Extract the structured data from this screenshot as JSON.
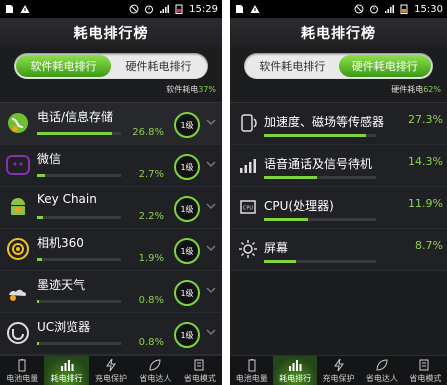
{
  "status": {
    "time": "15:29",
    "time_right": "15:30"
  },
  "left": {
    "title": "耗电排行榜",
    "tabs": [
      "软件耗电排行",
      "硬件耗电排行"
    ],
    "summary_label": "软件耗电",
    "summary_pct": "37%",
    "apps": [
      {
        "name": "电话/信息存储",
        "pct": "26.8%",
        "fill": 0.268,
        "level": "1级"
      },
      {
        "name": "微信",
        "pct": "2.7%",
        "fill": 0.027,
        "level": "1级"
      },
      {
        "name": "Key Chain",
        "pct": "2.2%",
        "fill": 0.022,
        "level": "1级"
      },
      {
        "name": "相机360",
        "pct": "1.9%",
        "fill": 0.019,
        "level": "1级"
      },
      {
        "name": "墨迹天气",
        "pct": "0.8%",
        "fill": 0.008,
        "level": "1级"
      },
      {
        "name": "UC浏览器",
        "pct": "0.8%",
        "fill": 0.008,
        "level": "1级"
      }
    ]
  },
  "right": {
    "title": "耗电排行榜",
    "tabs": [
      "软件耗电排行",
      "硬件耗电排行"
    ],
    "summary_label": "硬件耗电",
    "summary_pct": "62%",
    "hardware": [
      {
        "name": "加速度、磁场等传感器",
        "pct": "27.3%",
        "fill": 0.273,
        "icon": "sensor-icon"
      },
      {
        "name": "语音通话及信号待机",
        "pct": "14.3%",
        "fill": 0.143,
        "icon": "signal-icon"
      },
      {
        "name": "CPU(处理器)",
        "pct": "11.9%",
        "fill": 0.119,
        "icon": "cpu-icon"
      },
      {
        "name": "屏幕",
        "pct": "8.7%",
        "fill": 0.087,
        "icon": "brightness-icon"
      }
    ]
  },
  "nav": [
    "电池电量",
    "耗电排行",
    "充电保护",
    "省电达人",
    "省电模式"
  ]
}
